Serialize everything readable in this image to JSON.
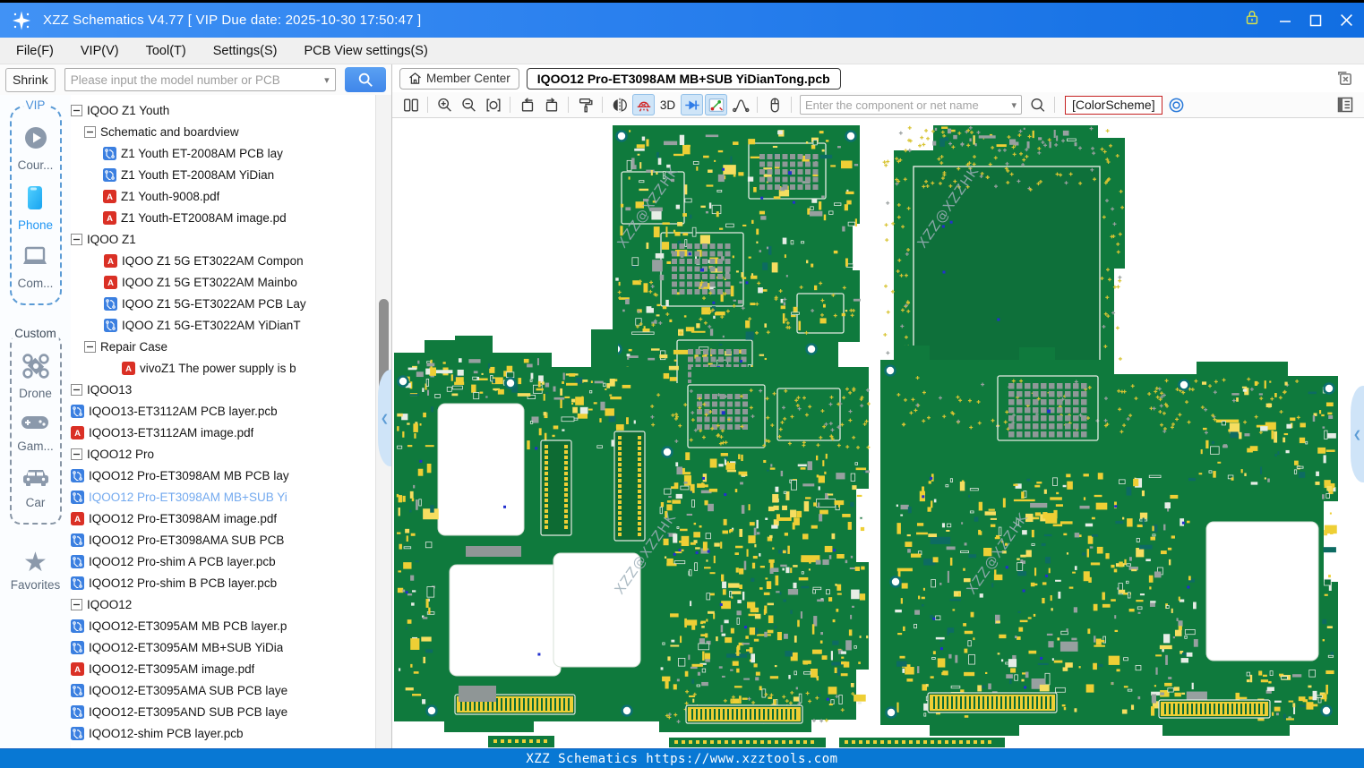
{
  "window": {
    "title": "XZZ Schematics V4.77 [ VIP Due date: 2025-10-30 17:50:47 ]",
    "control_icons": [
      "vip-lock-icon",
      "minimize-icon",
      "maximize-icon",
      "close-icon"
    ]
  },
  "menu": {
    "items": [
      "File(F)",
      "VIP(V)",
      "Tool(T)",
      "Settings(S)",
      "PCB View settings(S)"
    ]
  },
  "topbar": {
    "shrink_label": "Shrink",
    "search_placeholder": "Please input the model number or PCB",
    "search_button_icon": "search-icon",
    "member_center_label": "Member Center",
    "tab_title": "IQOO12 Pro-ET3098AM MB+SUB YiDianTong.pcb",
    "close_file_icon": "close-file-icon"
  },
  "toolbar": {
    "groups": [
      [
        "split-view"
      ],
      [
        "zoom-in",
        "zoom-out",
        "fit-view"
      ],
      [
        "rotate-left",
        "rotate-right"
      ],
      [
        "paint-roller"
      ],
      [
        "mirror-flip",
        "lamp",
        "three-d",
        "diode",
        "probe",
        "curve"
      ],
      [
        "mouse"
      ]
    ],
    "active_buttons": [
      "lamp",
      "diode",
      "probe"
    ],
    "three_d_label": "3D",
    "search_placeholder": "Enter the component or net name",
    "colorscheme_label": "[ColorScheme]",
    "right_icons": [
      "magnifier-icon",
      "eye-target-icon",
      "panel-list-icon"
    ]
  },
  "sidebar": {
    "groups": [
      {
        "label": "VIP",
        "style": "vip",
        "items": [
          {
            "icon": "play-icon",
            "label": "Cour...",
            "active": false
          },
          {
            "icon": "phone-icon",
            "label": "Phone",
            "active": true
          },
          {
            "icon": "laptop-icon",
            "label": "Com...",
            "active": false
          }
        ]
      },
      {
        "label": "Custom",
        "style": "custom",
        "items": [
          {
            "icon": "drone-icon",
            "label": "Drone",
            "active": false
          },
          {
            "icon": "gamepad-icon",
            "label": "Gam...",
            "active": false
          },
          {
            "icon": "car-icon",
            "label": "Car",
            "active": false
          }
        ]
      }
    ],
    "favorites_label": "Favorites"
  },
  "tree": {
    "items": [
      {
        "indent": 75,
        "type": "folder",
        "label": "IQOO Z1 Youth"
      },
      {
        "indent": 95,
        "type": "folder",
        "label": "Schematic and boardview"
      },
      {
        "indent": 116,
        "type": "pcb",
        "label": "Z1 Youth ET-2008AM PCB lay"
      },
      {
        "indent": 116,
        "type": "pcb",
        "label": "Z1 Youth ET-2008AM YiDian"
      },
      {
        "indent": 116,
        "type": "pdf",
        "label": "Z1 Youth-9008.pdf"
      },
      {
        "indent": 116,
        "type": "pdf",
        "label": "Z1 Youth-ET2008AM image.pd"
      },
      {
        "indent": 75,
        "type": "folder",
        "label": "IQOO Z1"
      },
      {
        "indent": 117,
        "type": "pdf",
        "label": "IQOO Z1 5G ET3022AM Compon"
      },
      {
        "indent": 117,
        "type": "pdf",
        "label": "IQOO Z1 5G ET3022AM Mainbo"
      },
      {
        "indent": 117,
        "type": "pcb",
        "label": "IQOO Z1 5G-ET3022AM PCB Lay"
      },
      {
        "indent": 117,
        "type": "pcb",
        "label": "IQOO Z1 5G-ET3022AM YiDianT"
      },
      {
        "indent": 95,
        "type": "folder",
        "label": "Repair Case"
      },
      {
        "indent": 137,
        "type": "pdf",
        "label": "vivoZ1 The power supply is b"
      },
      {
        "indent": 57,
        "type": "folder",
        "label": "IQOO13"
      },
      {
        "indent": 80,
        "type": "pcb",
        "label": "IQOO13-ET3112AM PCB layer.pcb"
      },
      {
        "indent": 80,
        "type": "pdf",
        "label": "IQOO13-ET3112AM image.pdf"
      },
      {
        "indent": 57,
        "type": "folder",
        "label": "IQOO12 Pro"
      },
      {
        "indent": 80,
        "type": "pcb",
        "label": "IQOO12 Pro-ET3098AM MB PCB lay"
      },
      {
        "indent": 80,
        "type": "pcb",
        "label": "IQOO12 Pro-ET3098AM MB+SUB Yi",
        "selected": true
      },
      {
        "indent": 80,
        "type": "pdf",
        "label": "IQOO12 Pro-ET3098AM image.pdf"
      },
      {
        "indent": 80,
        "type": "pcb",
        "label": "IQOO12 Pro-ET3098AMA SUB PCB"
      },
      {
        "indent": 80,
        "type": "pcb",
        "label": "IQOO12 Pro-shim A PCB layer.pcb"
      },
      {
        "indent": 80,
        "type": "pcb",
        "label": "IQOO12 Pro-shim B PCB layer.pcb"
      },
      {
        "indent": 57,
        "type": "folder",
        "label": "IQOO12"
      },
      {
        "indent": 80,
        "type": "pcb",
        "label": "IQOO12-ET3095AM MB PCB layer.p"
      },
      {
        "indent": 80,
        "type": "pcb",
        "label": "IQOO12-ET3095AM MB+SUB YiDia"
      },
      {
        "indent": 80,
        "type": "pdf",
        "label": "IQOO12-ET3095AM image.pdf"
      },
      {
        "indent": 80,
        "type": "pcb",
        "label": "IQOO12-ET3095AMA SUB PCB laye"
      },
      {
        "indent": 80,
        "type": "pcb",
        "label": "IQOO12-ET3095AND SUB PCB laye"
      },
      {
        "indent": 80,
        "type": "pcb",
        "label": "IQOO12-shim PCB layer.pcb"
      }
    ]
  },
  "canvas": {
    "watermark": "XZZ@XZZHK"
  },
  "statusbar": {
    "text": "XZZ Schematics https://www.xzztools.com"
  },
  "colors": {
    "titlebar_gradient_start": "#4192f5",
    "titlebar_gradient_end": "#116ee2",
    "accent_blue": "#2b7fe3",
    "selected_tree_item": "#74aaef",
    "status_bar_blue": "#0878d4",
    "colorscheme_border_red": "#c52222",
    "vip_phone_icon_blue": "#29b6f6",
    "pcb_green": "#0f7a3d",
    "pcb_component_yellow": "#eecf35",
    "pcb_pad_gray": "#97a0a0",
    "pcb_via_blue": "#2230cf",
    "vip_lock_icon_yellow": "#d9e34a"
  }
}
